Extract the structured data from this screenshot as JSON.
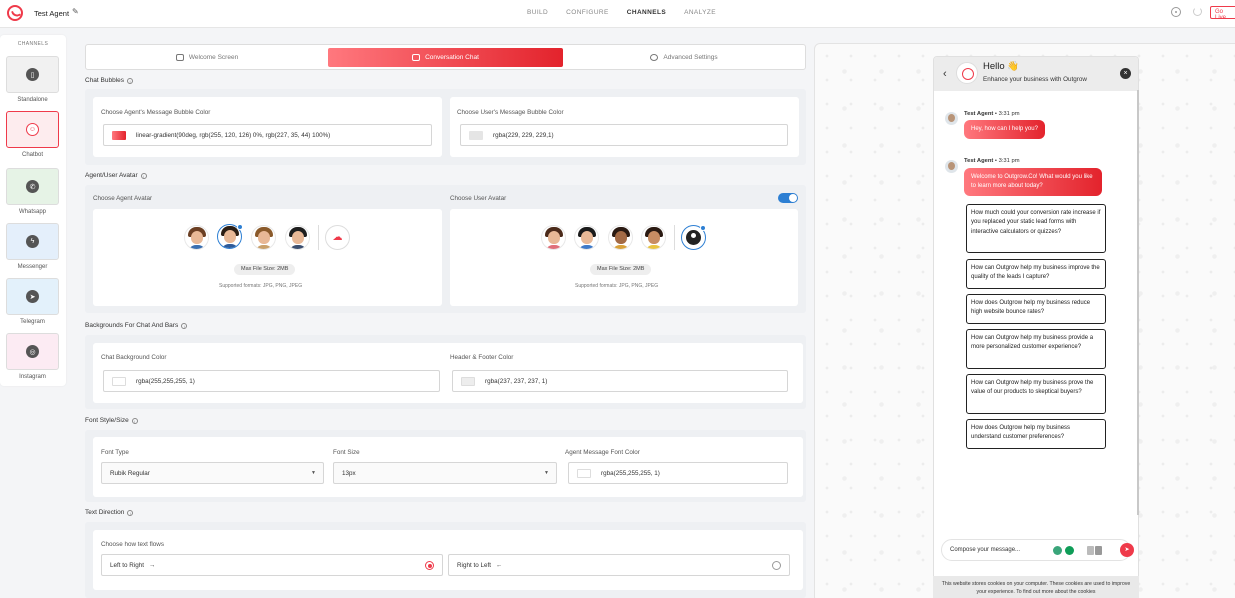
{
  "header": {
    "agent_name": "Test Agent",
    "nav": [
      "BUILD",
      "CONFIGURE",
      "CHANNELS",
      "ANALYZE"
    ],
    "active_nav": "CHANNELS",
    "go_live_label": "Go Live"
  },
  "channels": {
    "title": "CHANNELS",
    "items": [
      {
        "label": "Standalone",
        "icon": "mobile-icon",
        "color": "#f1f1f1"
      },
      {
        "label": "Chatbot",
        "icon": "chatbot-icon",
        "color": "#fdecee",
        "active": true
      },
      {
        "label": "Whatsapp",
        "icon": "whatsapp-icon",
        "color": "#e6f3e6"
      },
      {
        "label": "Messenger",
        "icon": "messenger-icon",
        "color": "#e4effb"
      },
      {
        "label": "Telegram",
        "icon": "telegram-icon",
        "color": "#e3f1fb"
      },
      {
        "label": "Instagram",
        "icon": "instagram-icon",
        "color": "#fcebf3"
      }
    ]
  },
  "tabs": [
    {
      "label": "Welcome Screen",
      "icon": "hand-icon"
    },
    {
      "label": "Conversation Chat",
      "icon": "chat-icon",
      "active": true
    },
    {
      "label": "Advanced Settings",
      "icon": "gear-icon"
    }
  ],
  "chat_bubbles": {
    "title": "Chat Bubbles",
    "agent_label": "Choose Agent's Message Bubble Color",
    "agent_value": "linear-gradient(90deg, rgb(255, 120, 126) 0%, rgb(227, 35, 44) 100%)",
    "user_label": "Choose User's Message Bubble Color",
    "user_value": "rgba(229, 229, 229,1)"
  },
  "avatars": {
    "title": "Agent/User Avatar",
    "agent_label": "Choose Agent Avatar",
    "user_label": "Choose User Avatar",
    "max_size": "Max File Size: 2MB",
    "formats": "Supported formats: JPG, PNG, JPEG",
    "user_avatar_enabled": true
  },
  "backgrounds": {
    "title": "Backgrounds For Chat And Bars",
    "chat_label": "Chat Background Color",
    "chat_value": "rgba(255,255,255, 1)",
    "hf_label": "Header & Footer Color",
    "hf_value": "rgba(237, 237, 237, 1)"
  },
  "font": {
    "title": "Font Style/Size",
    "type_label": "Font Type",
    "type_value": "Rubik Regular",
    "size_label": "Font Size",
    "size_value": "13px",
    "color_label": "Agent Message Font Color",
    "color_value": "rgba(255,255,255, 1)"
  },
  "direction": {
    "title": "Text Direction",
    "label": "Choose how text flows",
    "ltr": "Left to Right",
    "ltr_arrow": "→",
    "rtl": "Right to Left",
    "rtl_arrow": "←",
    "selected": "ltr"
  },
  "preview": {
    "header_title": "Hello 👋",
    "header_sub": "Enhance your business with Outgrow",
    "agent": "Test Agent",
    "time": "3:31 pm",
    "msg1": "Hey, how can I help you?",
    "msg2": "Welcome to Outgrow.Co! What would you like to learn more about today?",
    "options": [
      "How much could your conversion rate increase if you replaced your static lead forms with interactive calculators or quizzes?",
      "How can Outgrow help my business improve the quality of the leads I capture?",
      "How does Outgrow help my business reduce high website bounce rates?",
      "How can Outgrow help my business provide a more personalized customer experience?",
      "How can Outgrow help my business prove the value of our products to skeptical buyers?",
      "How does Outgrow help my business understand customer preferences?"
    ],
    "compose_placeholder": "Compose your message...",
    "cookie_text": "This website stores cookies on your computer. These cookies are used to improve your experience. To find out more about the cookies"
  },
  "colors": {
    "accent": "#ef3a4a",
    "blue": "#2d7fd3"
  }
}
